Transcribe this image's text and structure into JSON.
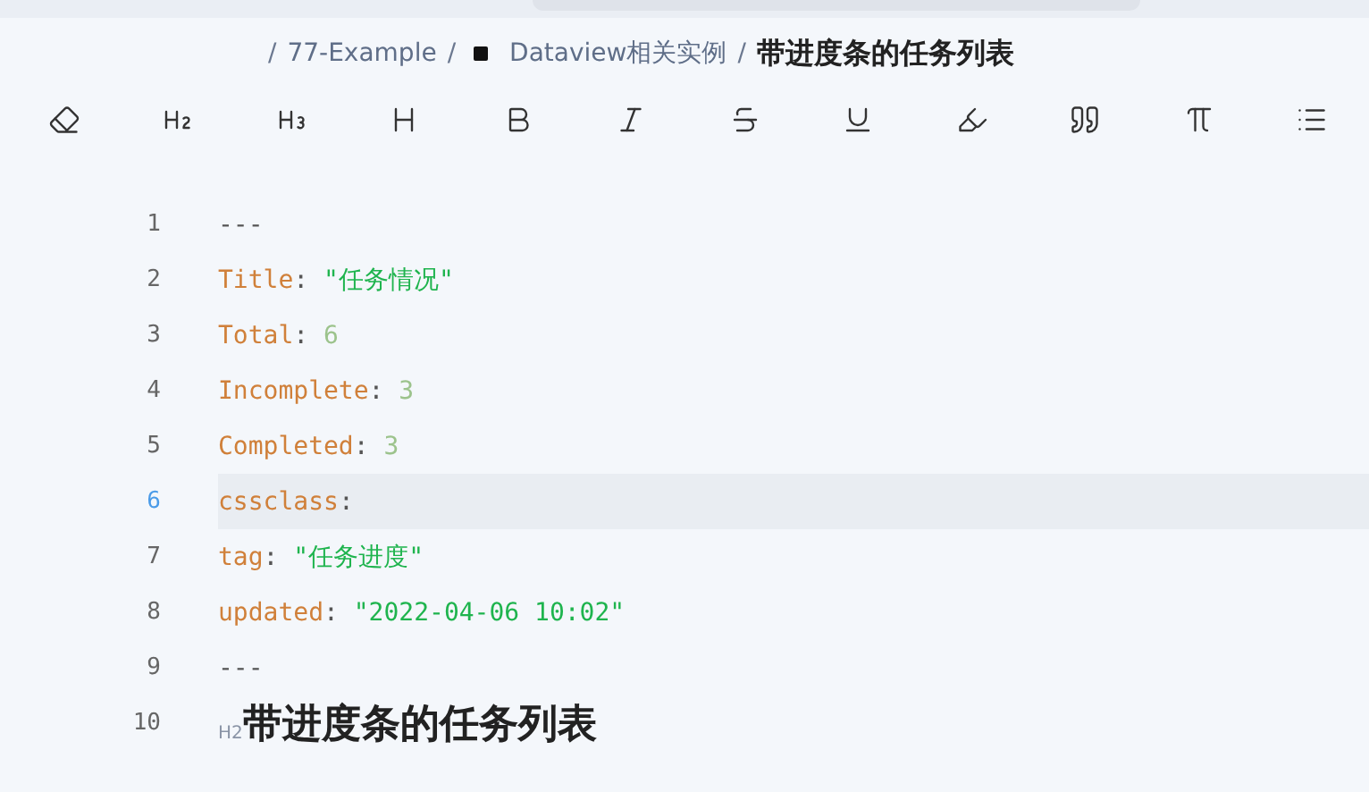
{
  "breadcrumb": [
    {
      "kind": "separator",
      "text": "/"
    },
    {
      "kind": "link",
      "text": "77-Example"
    },
    {
      "kind": "separator",
      "text": "/"
    },
    {
      "kind": "link-with-icon",
      "text": "Dataview相关实例"
    },
    {
      "kind": "separator",
      "text": "/"
    },
    {
      "kind": "current",
      "text": "带进度条的任务列表"
    }
  ],
  "toolbar": [
    {
      "kind": "eraser"
    },
    {
      "kind": "h2"
    },
    {
      "kind": "h3"
    },
    {
      "kind": "hn"
    },
    {
      "kind": "bold"
    },
    {
      "kind": "italic"
    },
    {
      "kind": "strike"
    },
    {
      "kind": "underline"
    },
    {
      "kind": "highlight"
    },
    {
      "kind": "quote"
    },
    {
      "kind": "formula"
    },
    {
      "kind": "list"
    }
  ],
  "lines": [
    {
      "number": "1",
      "active": false,
      "kind": "code",
      "tokens": [
        {
          "kind": "punct",
          "text": "---"
        }
      ]
    },
    {
      "number": "2",
      "active": false,
      "kind": "code",
      "tokens": [
        {
          "kind": "key",
          "text": "Title"
        },
        {
          "kind": "punct",
          "text": ": "
        },
        {
          "kind": "string",
          "text": "\"任务情况\""
        }
      ]
    },
    {
      "number": "3",
      "active": false,
      "kind": "code",
      "tokens": [
        {
          "kind": "key",
          "text": "Total"
        },
        {
          "kind": "punct",
          "text": ": "
        },
        {
          "kind": "number",
          "text": "6"
        }
      ]
    },
    {
      "number": "4",
      "active": false,
      "kind": "code",
      "tokens": [
        {
          "kind": "key",
          "text": "Incomplete"
        },
        {
          "kind": "punct",
          "text": ": "
        },
        {
          "kind": "number",
          "text": "3"
        }
      ]
    },
    {
      "number": "5",
      "active": false,
      "kind": "code",
      "tokens": [
        {
          "kind": "key",
          "text": "Completed"
        },
        {
          "kind": "punct",
          "text": ": "
        },
        {
          "kind": "number",
          "text": "3"
        }
      ]
    },
    {
      "number": "6",
      "active": true,
      "kind": "code",
      "tokens": [
        {
          "kind": "key",
          "text": "cssclass"
        },
        {
          "kind": "punct",
          "text": ":"
        }
      ]
    },
    {
      "number": "7",
      "active": false,
      "kind": "code",
      "tokens": [
        {
          "kind": "key",
          "text": "tag"
        },
        {
          "kind": "punct",
          "text": ": "
        },
        {
          "kind": "string",
          "text": "\"任务进度\""
        }
      ]
    },
    {
      "number": "8",
      "active": false,
      "kind": "code",
      "tokens": [
        {
          "kind": "key",
          "text": "updated"
        },
        {
          "kind": "punct",
          "text": ": "
        },
        {
          "kind": "string",
          "text": "\"2022-04-06 10:02\""
        }
      ]
    },
    {
      "number": "9",
      "active": false,
      "kind": "code",
      "tokens": [
        {
          "kind": "punct",
          "text": "---"
        }
      ]
    },
    {
      "number": "10",
      "active": false,
      "kind": "heading",
      "marker": "H2",
      "text": "带进度条的任务列表"
    }
  ]
}
